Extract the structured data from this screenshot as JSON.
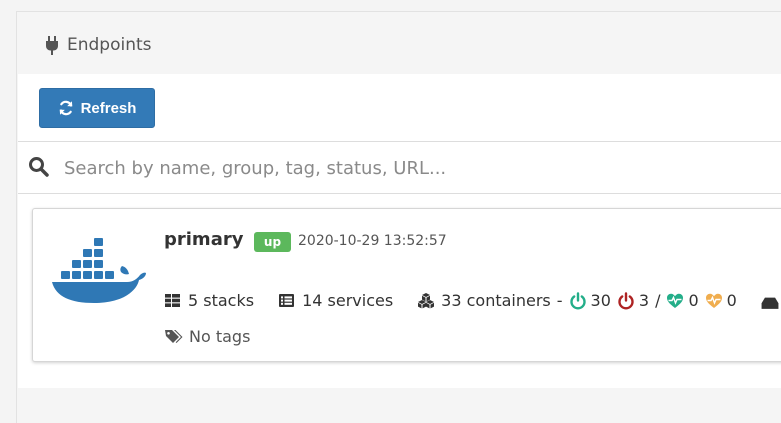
{
  "header": {
    "title": "Endpoints",
    "icon": "plug-icon"
  },
  "toolbar": {
    "refresh_label": "Refresh",
    "refresh_icon": "refresh-icon",
    "button_color": "#337ab7"
  },
  "search": {
    "value": "",
    "placeholder": "Search by name, group, tag, status, URL..."
  },
  "endpoints": [
    {
      "name": "primary",
      "status": "up",
      "status_color": "#5cb85c",
      "timestamp": "2020-10-29 13:52:57",
      "stacks": "5 stacks",
      "services": "14 services",
      "containers": "33 containers",
      "container_separator": "-",
      "running": "30",
      "stopped": "3",
      "slash": "/",
      "healthy": "0",
      "unhealthy": "0",
      "tags": "No tags",
      "logo": "docker-logo",
      "colors": {
        "running": "#23ae89",
        "stopped": "#ae2323",
        "healthy": "#23ae89",
        "unhealthy": "#f0ad4e"
      }
    }
  ]
}
